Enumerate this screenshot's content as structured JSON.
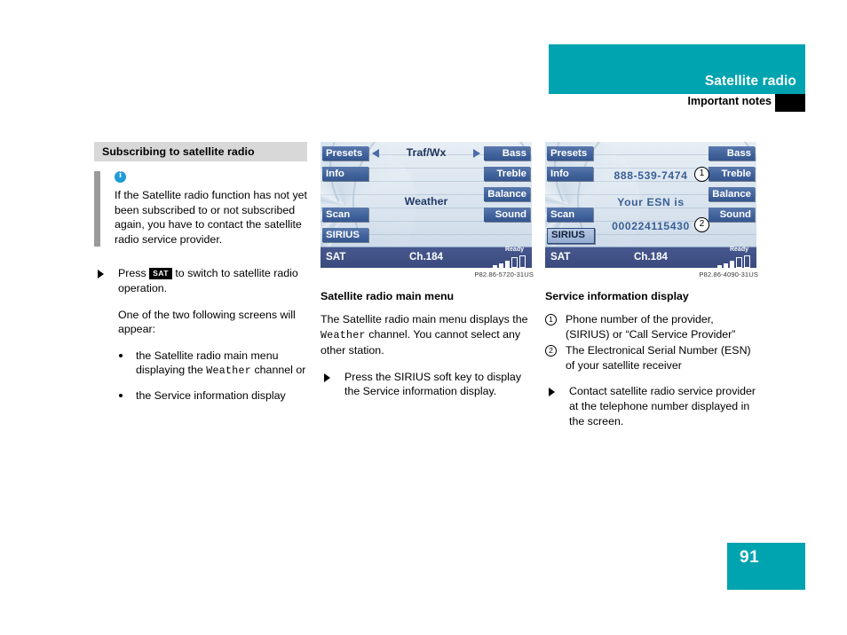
{
  "header": {
    "title": "Satellite radio",
    "subtitle": "Important notes",
    "accent_color": "#00a3b0"
  },
  "footer": {
    "page_number": "91"
  },
  "left_column": {
    "section_heading": "Subscribing to satellite radio",
    "note": {
      "icon": "info-icon",
      "text": "If the Satellite radio function has not yet been subscribed to or not subscribed again, you have to contact the satellite radio service provider."
    },
    "instruction": {
      "prefix": "Press",
      "key_label": "SAT",
      "suffix": "to switch to satellite radio operation."
    },
    "lead_in": "One of the two following screens will appear:",
    "bullets": [
      {
        "before": "the Satellite radio main menu displaying the ",
        "mono": "Weather",
        "after": " channel or"
      },
      {
        "before": "the Service information display",
        "mono": "",
        "after": ""
      }
    ]
  },
  "middle_column": {
    "display": {
      "left_softkeys": [
        "Presets",
        "Info",
        "Scan",
        "SIRIUS"
      ],
      "right_softkeys": [
        "Bass",
        "Treble",
        "Balance",
        "Sound"
      ],
      "top_label": "Traf/Wx",
      "left_arrow": "left-arrow-icon",
      "right_arrow": "right-arrow-icon",
      "center_label": "Weather",
      "status_source": "SAT",
      "status_channel": "Ch.184",
      "status_ready": "Ready",
      "signal_bars": 5,
      "signal_filled": 3
    },
    "image_code": "P82.86-5720-31US",
    "caption": "Satellite radio main menu",
    "body": {
      "before": "The Satellite radio main menu displays the ",
      "mono": "Weather",
      "after": " channel. You cannot select any other station."
    },
    "instruction": "Press the SIRIUS soft key to display the Service information display."
  },
  "right_column": {
    "display": {
      "left_softkeys": [
        "Presets",
        "Info",
        "Scan",
        "SIRIUS"
      ],
      "active_softkey": "SIRIUS",
      "right_softkeys": [
        "Bass",
        "Treble",
        "Balance",
        "Sound"
      ],
      "phone_number": "888-539-7474",
      "esn_label": "Your ESN is",
      "esn_number": "000224115430",
      "callout_1": "1",
      "callout_2": "2",
      "status_source": "SAT",
      "status_channel": "Ch.184",
      "status_ready": "Ready",
      "signal_bars": 5,
      "signal_filled": 3
    },
    "image_code": "P82.86-4090-31US",
    "caption": "Service information display",
    "numbered_items": [
      {
        "num": "1",
        "text": "Phone number of the provider, (SIRIUS) or “Call Service Provider”"
      },
      {
        "num": "2",
        "text": "The Electronical Serial Number (ESN) of your satellite receiver"
      }
    ],
    "instruction": "Contact satellite radio service provider at the telephone number displayed in the screen."
  }
}
